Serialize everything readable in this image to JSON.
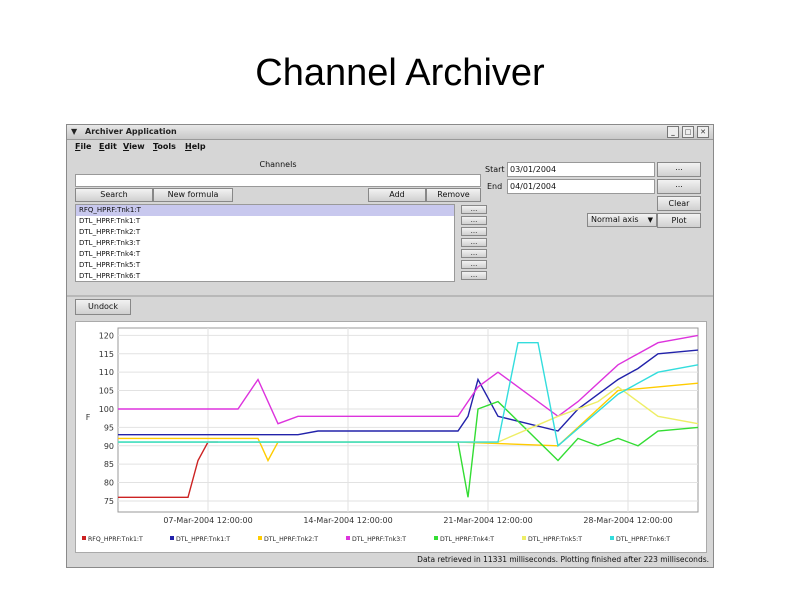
{
  "slide": {
    "title": "Channel Archiver"
  },
  "window": {
    "title": "Archiver Application",
    "menu": [
      "File",
      "Edit",
      "View",
      "Tools",
      "Help"
    ]
  },
  "channels": {
    "header": "Channels",
    "buttons": {
      "search": "Search",
      "new_formula": "New formula",
      "add": "Add",
      "remove": "Remove",
      "row_button": "..."
    },
    "list": [
      "RFQ_HPRF:Tnk1:T",
      "DTL_HPRF:Tnk1:T",
      "DTL_HPRF:Tnk2:T",
      "DTL_HPRF:Tnk3:T",
      "DTL_HPRF:Tnk4:T",
      "DTL_HPRF:Tnk5:T",
      "DTL_HPRF:Tnk6:T"
    ]
  },
  "time_range": {
    "start_label": "Start",
    "start_value": "03/01/2004",
    "end_label": "End",
    "end_value": "04/01/2004",
    "browse_button": "...",
    "clear_button": "Clear",
    "axis_mode": "Normal axis",
    "plot_button": "Plot"
  },
  "undock_button": "Undock",
  "status": "Data retrieved in 11331 milliseconds. Plotting finished after 223 milliseconds.",
  "colors": {
    "RFQ_HPRF:Tnk1:T": "#cc2222",
    "DTL_HPRF:Tnk1:T": "#2222aa",
    "DTL_HPRF:Tnk2:T": "#ffcc00",
    "DTL_HPRF:Tnk3:T": "#dd33dd",
    "DTL_HPRF:Tnk4:T": "#33dd33",
    "DTL_HPRF:Tnk5:T": "#eeee66",
    "DTL_HPRF:Tnk6:T": "#33dddd"
  },
  "chart_data": {
    "type": "line",
    "ylabel": "F",
    "ylim": [
      72,
      122
    ],
    "xlim": [
      "2004-03-03",
      "2004-04-01"
    ],
    "y_ticks": [
      75,
      80,
      85,
      90,
      95,
      100,
      105,
      110,
      115,
      120
    ],
    "x_ticks": [
      {
        "label": "07-Mar-2004 12:00:00",
        "x": "2004-03-07T12:00"
      },
      {
        "label": "14-Mar-2004 12:00:00",
        "x": "2004-03-14T12:00"
      },
      {
        "label": "21-Mar-2004 12:00:00",
        "x": "2004-03-21T12:00"
      },
      {
        "label": "28-Mar-2004 12:00:00",
        "x": "2004-03-28T12:00"
      }
    ],
    "grid": true,
    "legend": "bottom",
    "series": [
      {
        "name": "RFQ_HPRF:Tnk1:T",
        "x": [
          "2004-03-03",
          "2004-03-06T12:00",
          "2004-03-07",
          "2004-03-07T12:00",
          "2004-03-08"
        ],
        "y": [
          76,
          76,
          86,
          91,
          91
        ]
      },
      {
        "name": "DTL_HPRF:Tnk1:T",
        "x": [
          "2004-03-03",
          "2004-03-12",
          "2004-03-13",
          "2004-03-20",
          "2004-03-20T12:00",
          "2004-03-21",
          "2004-03-22",
          "2004-03-25",
          "2004-03-26",
          "2004-03-28",
          "2004-03-29",
          "2004-03-30",
          "2004-04-01"
        ],
        "y": [
          93,
          93,
          94,
          94,
          98,
          108,
          98,
          94,
          100,
          108,
          111,
          115,
          116
        ]
      },
      {
        "name": "DTL_HPRF:Tnk2:T",
        "x": [
          "2004-03-03",
          "2004-03-10",
          "2004-03-10T12:00",
          "2004-03-11",
          "2004-03-20",
          "2004-03-25",
          "2004-03-27",
          "2004-03-28",
          "2004-04-01"
        ],
        "y": [
          92,
          92,
          86,
          91,
          91,
          90,
          100,
          105,
          107
        ]
      },
      {
        "name": "DTL_HPRF:Tnk3:T",
        "x": [
          "2004-03-03",
          "2004-03-09",
          "2004-03-10",
          "2004-03-11",
          "2004-03-12",
          "2004-03-20",
          "2004-03-21",
          "2004-03-22",
          "2004-03-25",
          "2004-03-26",
          "2004-03-28",
          "2004-03-30",
          "2004-04-01"
        ],
        "y": [
          100,
          100,
          108,
          96,
          98,
          98,
          106,
          110,
          98,
          102,
          112,
          118,
          120
        ]
      },
      {
        "name": "DTL_HPRF:Tnk4:T",
        "x": [
          "2004-03-03",
          "2004-03-20",
          "2004-03-20T12:00",
          "2004-03-21",
          "2004-03-22",
          "2004-03-25",
          "2004-03-26",
          "2004-03-27",
          "2004-03-28",
          "2004-03-29",
          "2004-03-30",
          "2004-04-01"
        ],
        "y": [
          91,
          91,
          76,
          100,
          102,
          86,
          92,
          90,
          92,
          90,
          94,
          95
        ]
      },
      {
        "name": "DTL_HPRF:Tnk5:T",
        "x": [
          "2004-03-03",
          "2004-03-22",
          "2004-03-25",
          "2004-03-27",
          "2004-03-28",
          "2004-03-30",
          "2004-04-01"
        ],
        "y": [
          91,
          91,
          98,
          102,
          106,
          98,
          96
        ]
      },
      {
        "name": "DTL_HPRF:Tnk6:T",
        "x": [
          "2004-03-03",
          "2004-03-21",
          "2004-03-22",
          "2004-03-23",
          "2004-03-24",
          "2004-03-25",
          "2004-03-28",
          "2004-03-30",
          "2004-04-01"
        ],
        "y": [
          91,
          91,
          91,
          118,
          118,
          90,
          104,
          110,
          112
        ]
      }
    ]
  }
}
